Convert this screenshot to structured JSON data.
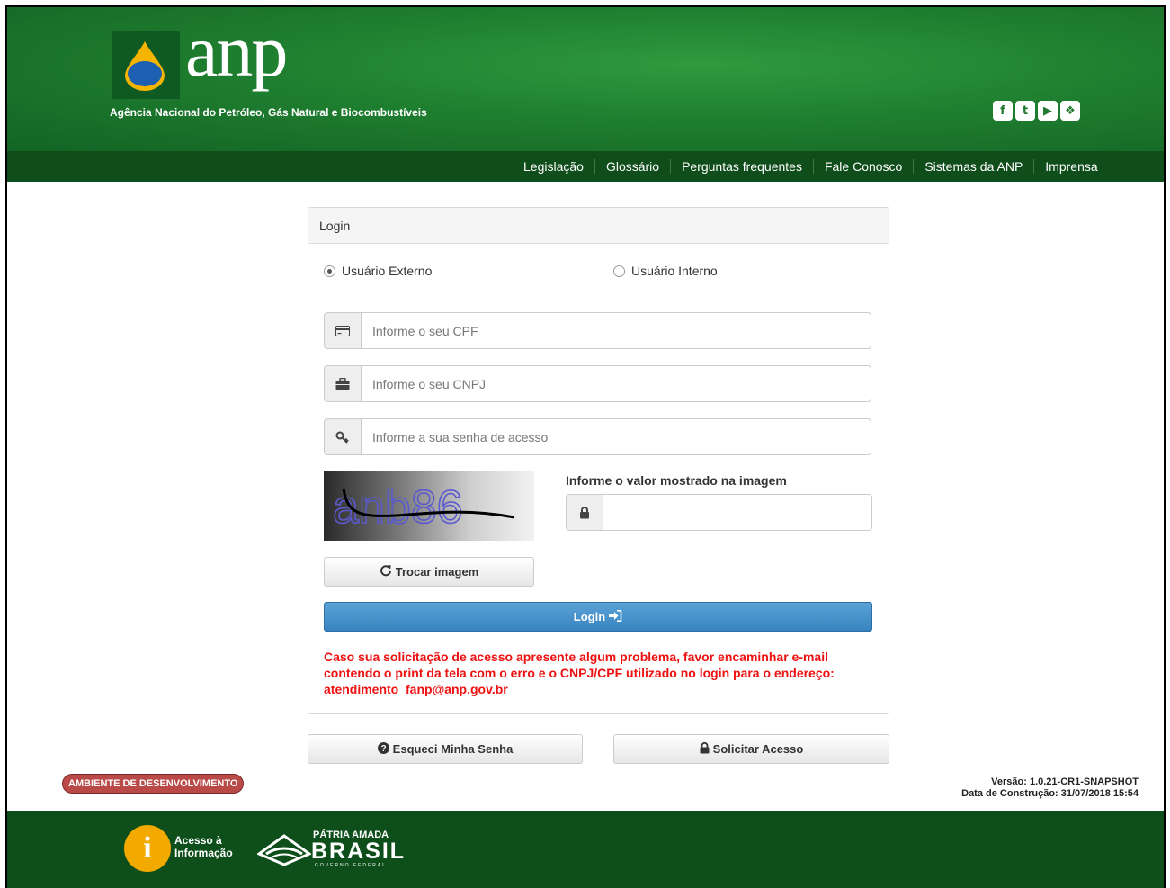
{
  "header": {
    "logo_text": "anp",
    "tagline": "Agência Nacional do Petróleo, Gás Natural e Biocombustíveis",
    "social": [
      {
        "icon": "facebook-icon",
        "glyph": "f"
      },
      {
        "icon": "twitter-icon",
        "glyph": "t"
      },
      {
        "icon": "youtube-icon",
        "glyph": "▶"
      },
      {
        "icon": "flickr-icon",
        "glyph": "❖"
      }
    ]
  },
  "nav": {
    "items": [
      "Legislação",
      "Glossário",
      "Perguntas frequentes",
      "Fale Conosco",
      "Sistemas da ANP",
      "Imprensa"
    ]
  },
  "login": {
    "panel_title": "Login",
    "radio_externo": "Usuário Externo",
    "radio_interno": "Usuário Interno",
    "selected": "Usuário Externo",
    "cpf_placeholder": "Informe o seu CPF",
    "cnpj_placeholder": "Informe o seu CNPJ",
    "senha_placeholder": "Informe a sua senha de acesso",
    "captcha_text": "anb86",
    "captcha_label": "Informe o valor mostrado na imagem",
    "captcha_value": "",
    "trocar_label": "Trocar imagem",
    "login_label": "Login",
    "warning": "Caso sua solicitação de acesso apresente algum problema, favor encaminhar e-mail contendo o print da tela com o erro e o CNPJ/CPF utilizado no login para o endereço: atendimento_fanp@anp.gov.br"
  },
  "actions": {
    "esqueci_label": "Esqueci Minha Senha",
    "solicitar_label": "Solicitar Acesso"
  },
  "env_badge": "AMBIENTE DE DESENVOLVIMENTO",
  "version": {
    "line1": "Versão: 1.0.21-CR1-SNAPSHOT",
    "line2": "Data de Construção: 31/07/2018 15:54"
  },
  "footer": {
    "acesso_line1": "Acesso à",
    "acesso_line2": "Informação",
    "brasil_top": "PÁTRIA AMADA",
    "brasil_main": "BRASIL",
    "brasil_sub": "GOVERNO FEDERAL"
  },
  "colors": {
    "header_green": "#1f7f30",
    "nav_green": "#0f4d1a",
    "login_blue": "#4a94cd",
    "warning_red": "#ee1111",
    "badge_red": "#b94a48"
  }
}
